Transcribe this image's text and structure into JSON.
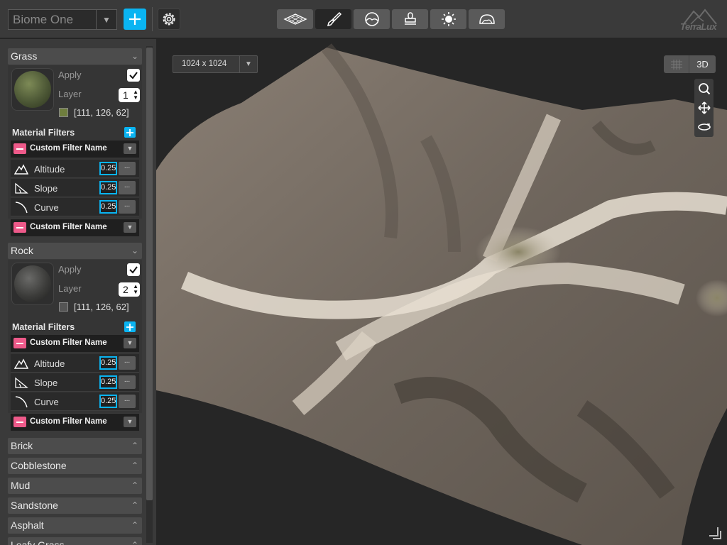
{
  "toolbar": {
    "biome_select_value": "Biome One",
    "logo_text": "TerraLux",
    "tools": [
      {
        "icon": "terrain-plane-icon",
        "active": false
      },
      {
        "icon": "paint-brush-icon",
        "active": true
      },
      {
        "icon": "water-level-icon",
        "active": false
      },
      {
        "icon": "stamp-icon",
        "active": false
      },
      {
        "icon": "sun-icon",
        "active": false
      },
      {
        "icon": "sky-dome-icon",
        "active": false
      }
    ]
  },
  "sidebar": {
    "grass": {
      "name": "Grass",
      "apply_label": "Apply",
      "layer_label": "Layer",
      "layer_value": "1",
      "color_text": "[111, 126, 62]",
      "swatch_color": "#6f7e3e",
      "filters_title": "Material Filters",
      "filter_name_1": "Custom Filter Name",
      "altitude_label": "Altitude",
      "altitude_value": "0.25",
      "slope_label": "Slope",
      "slope_value": "0.25",
      "curve_label": "Curve",
      "curve_value": "0.25",
      "filter_name_2": "Custom Filter Name"
    },
    "rock": {
      "name": "Rock",
      "apply_label": "Apply",
      "layer_label": "Layer",
      "layer_value": "2",
      "color_text": "[111, 126, 62]",
      "swatch_color": "#555555",
      "filters_title": "Material Filters",
      "filter_name_1": "Custom Filter Name",
      "altitude_label": "Altitude",
      "altitude_value": "0.25",
      "slope_label": "Slope",
      "slope_value": "0.25",
      "curve_label": "Curve",
      "curve_value": "0.25",
      "filter_name_2": "Custom Filter Name"
    },
    "collapsed": [
      "Brick",
      "Cobblestone",
      "Mud",
      "Sandstone",
      "Asphalt",
      "Leafy Grass"
    ],
    "more_button": "..."
  },
  "viewport": {
    "resolution": "1024 x 1024",
    "view_mode": "3D"
  },
  "colors": {
    "accent": "#0ab4f2",
    "remove": "#ee5a8a"
  }
}
